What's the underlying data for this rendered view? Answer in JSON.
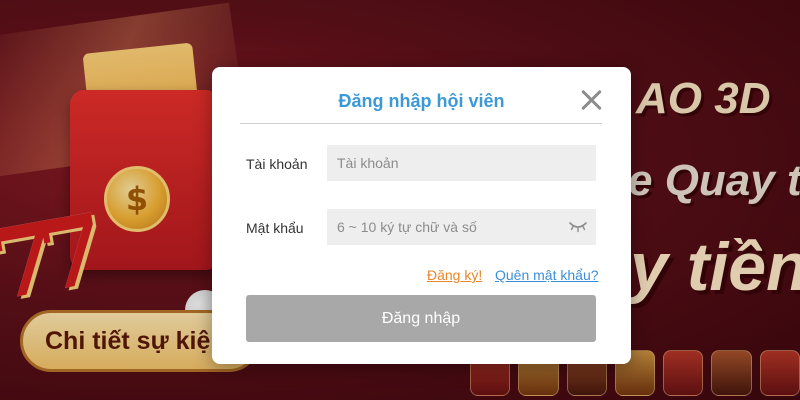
{
  "background": {
    "detail_button": "Chi tiết sự kiện",
    "promo_line_1": "AO 3D",
    "promo_line_2": "e Quay th",
    "promo_line_3": "y tiền",
    "envelope_symbol": "$",
    "slot_digits": "77"
  },
  "modal": {
    "title": "Đăng nhập hội viên",
    "close_icon": "close-icon",
    "account_label": "Tài khoản",
    "account_placeholder": "Tài khoản",
    "account_value": "",
    "password_label": "Mật khẩu",
    "password_placeholder": "6 ~ 10 ký tự chữ và số",
    "password_value": "",
    "password_toggle_icon": "eye-closed-icon",
    "register_link": "Đăng ký!",
    "forgot_link": "Quên mật khẩu?",
    "login_button": "Đăng nhập"
  },
  "colors": {
    "title": "#3c99d8",
    "register_link": "#e8862a",
    "forgot_link": "#3c8fd6",
    "login_button_bg": "#a8a8a8"
  }
}
